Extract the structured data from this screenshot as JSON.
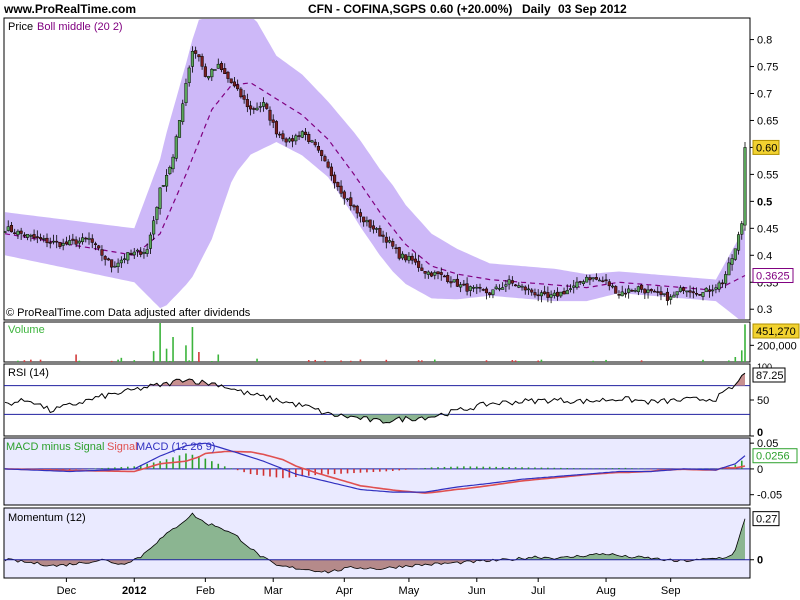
{
  "header": {
    "site": "www.ProRealTime.com",
    "instrument": "CFN - COFINA,SGPS",
    "quote": "0.60 (+20.00%)",
    "period": "Daily",
    "date": "03 Sep 2012"
  },
  "colors": {
    "bollinger_band": "#cdb8f8",
    "bollinger_middle": "#800080",
    "candle_up": "#5aa55a",
    "candle_down": "#7a1f1f",
    "volume_up": "#3cb43c",
    "volume_down": "#d23c3c",
    "macd_line": "#3030c0",
    "signal_line": "#e05050",
    "hist_up": "#2ca02c",
    "hist_down": "#d03030",
    "momentum_fill": "#8bb591",
    "panel_bg": "#eaeaff",
    "last_price_bg": "#f2d230"
  },
  "x_axis_labels": [
    "Dec",
    "2012",
    "Feb",
    "Mar",
    "Apr",
    "May",
    "Jun",
    "Jul",
    "Aug",
    "Sep"
  ],
  "chart_data": [
    {
      "type": "candlestick",
      "panel": "price",
      "title": "Price",
      "overlay_label": "Boll middle (20 2)",
      "footnote": "© ProRealTime.com Data adjusted after dividends",
      "ylim": [
        0.28,
        0.84
      ],
      "y_ticks": [
        0.3,
        0.35,
        0.4,
        0.45,
        0.5,
        0.55,
        0.6,
        0.65,
        0.7,
        0.75,
        0.8
      ],
      "y_tick_labels": [
        "0.3",
        "0.35",
        "0.4",
        "0.45",
        "0.5",
        "0.55",
        "0.6",
        "0.65",
        "0.7",
        "0.75",
        "0.8"
      ],
      "last_price": 0.6,
      "last_price_label": "0.60",
      "boll_middle_last": 0.3625,
      "boll_middle_last_label": "0.3625",
      "close_anchors": [
        [
          0,
          0.45
        ],
        [
          10,
          0.43
        ],
        [
          18,
          0.42
        ],
        [
          26,
          0.43
        ],
        [
          33,
          0.38
        ],
        [
          38,
          0.4
        ],
        [
          44,
          0.41
        ],
        [
          48,
          0.52
        ],
        [
          52,
          0.58
        ],
        [
          56,
          0.72
        ],
        [
          58,
          0.78
        ],
        [
          60,
          0.77
        ],
        [
          62,
          0.73
        ],
        [
          66,
          0.75
        ],
        [
          70,
          0.72
        ],
        [
          76,
          0.67
        ],
        [
          80,
          0.68
        ],
        [
          84,
          0.63
        ],
        [
          88,
          0.61
        ],
        [
          92,
          0.63
        ],
        [
          96,
          0.6
        ],
        [
          100,
          0.56
        ],
        [
          104,
          0.52
        ],
        [
          110,
          0.47
        ],
        [
          114,
          0.45
        ],
        [
          118,
          0.43
        ],
        [
          122,
          0.4
        ],
        [
          126,
          0.39
        ],
        [
          130,
          0.37
        ],
        [
          136,
          0.36
        ],
        [
          142,
          0.34
        ],
        [
          150,
          0.33
        ],
        [
          156,
          0.35
        ],
        [
          160,
          0.34
        ],
        [
          168,
          0.32
        ],
        [
          172,
          0.33
        ],
        [
          176,
          0.34
        ],
        [
          180,
          0.36
        ],
        [
          186,
          0.35
        ],
        [
          190,
          0.33
        ],
        [
          196,
          0.34
        ],
        [
          200,
          0.33
        ],
        [
          206,
          0.32
        ],
        [
          210,
          0.34
        ],
        [
          216,
          0.33
        ],
        [
          222,
          0.35
        ],
        [
          226,
          0.41
        ],
        [
          228,
          0.46
        ],
        [
          229,
          0.6
        ]
      ],
      "boll_middle_anchors": [
        [
          0,
          0.44
        ],
        [
          20,
          0.42
        ],
        [
          40,
          0.4
        ],
        [
          48,
          0.44
        ],
        [
          56,
          0.55
        ],
        [
          64,
          0.67
        ],
        [
          70,
          0.715
        ],
        [
          76,
          0.72
        ],
        [
          84,
          0.69
        ],
        [
          92,
          0.66
        ],
        [
          100,
          0.615
        ],
        [
          108,
          0.55
        ],
        [
          116,
          0.48
        ],
        [
          124,
          0.42
        ],
        [
          132,
          0.38
        ],
        [
          140,
          0.365
        ],
        [
          150,
          0.355
        ],
        [
          160,
          0.35
        ],
        [
          170,
          0.345
        ],
        [
          180,
          0.34
        ],
        [
          190,
          0.35
        ],
        [
          200,
          0.345
        ],
        [
          210,
          0.34
        ],
        [
          220,
          0.335
        ],
        [
          229,
          0.3625
        ]
      ],
      "boll_halfwidth_anchors": [
        [
          0,
          0.04
        ],
        [
          40,
          0.05
        ],
        [
          50,
          0.16
        ],
        [
          58,
          0.22
        ],
        [
          64,
          0.24
        ],
        [
          72,
          0.16
        ],
        [
          84,
          0.08
        ],
        [
          100,
          0.07
        ],
        [
          110,
          0.08
        ],
        [
          120,
          0.08
        ],
        [
          132,
          0.06
        ],
        [
          150,
          0.03
        ],
        [
          170,
          0.03
        ],
        [
          190,
          0.02
        ],
        [
          210,
          0.02
        ],
        [
          220,
          0.02
        ],
        [
          229,
          0.09
        ]
      ]
    },
    {
      "type": "bar",
      "panel": "volume",
      "title": "Volume",
      "y_ticks": [
        200000
      ],
      "y_tick_labels": [
        "200,000"
      ],
      "last_value": 451270,
      "last_value_label": "451,270",
      "ylim": [
        0,
        480000
      ],
      "spikes": [
        [
          22,
          90000
        ],
        [
          36,
          50000
        ],
        [
          46,
          130000
        ],
        [
          48,
          480000
        ],
        [
          50,
          160000
        ],
        [
          52,
          300000
        ],
        [
          56,
          200000
        ],
        [
          58,
          420000
        ],
        [
          60,
          120000
        ],
        [
          66,
          90000
        ],
        [
          78,
          40000
        ],
        [
          110,
          30000
        ],
        [
          186,
          25000
        ],
        [
          226,
          60000
        ],
        [
          228,
          140000
        ],
        [
          229,
          451270
        ]
      ]
    },
    {
      "type": "line",
      "panel": "rsi",
      "title": "RSI (14)",
      "ylim": [
        0,
        100
      ],
      "y_ticks": [
        0,
        50
      ],
      "y_tick_labels": [
        "0",
        "50"
      ],
      "top_tick_label": "100",
      "levels": [
        70,
        30
      ],
      "last_value": 87.25,
      "last_value_label": "87.25",
      "anchors": [
        [
          0,
          45
        ],
        [
          8,
          50
        ],
        [
          14,
          35
        ],
        [
          22,
          45
        ],
        [
          30,
          55
        ],
        [
          38,
          62
        ],
        [
          44,
          68
        ],
        [
          50,
          72
        ],
        [
          56,
          80
        ],
        [
          60,
          75
        ],
        [
          66,
          72
        ],
        [
          74,
          60
        ],
        [
          84,
          50
        ],
        [
          94,
          40
        ],
        [
          100,
          30
        ],
        [
          108,
          26
        ],
        [
          116,
          20
        ],
        [
          124,
          24
        ],
        [
          132,
          27
        ],
        [
          140,
          35
        ],
        [
          150,
          45
        ],
        [
          160,
          48
        ],
        [
          170,
          50
        ],
        [
          180,
          48
        ],
        [
          190,
          52
        ],
        [
          200,
          47
        ],
        [
          210,
          50
        ],
        [
          220,
          52
        ],
        [
          226,
          70
        ],
        [
          229,
          87.25
        ]
      ]
    },
    {
      "type": "line",
      "panel": "macd",
      "title": "MACD minus Signal",
      "series": [
        {
          "name": "MACD minus Signal"
        },
        {
          "name": "Signal"
        },
        {
          "name": "MACD (12 26 9)"
        }
      ],
      "ylim": [
        -0.07,
        0.06
      ],
      "y_ticks": [
        0.05,
        0,
        -0.05
      ],
      "y_tick_labels": [
        "0.05",
        "0",
        "-0.05"
      ],
      "last_value": 0.0256,
      "last_value_label": "0.0256",
      "macd_anchors": [
        [
          0,
          0.0
        ],
        [
          20,
          -0.005
        ],
        [
          40,
          0.0
        ],
        [
          48,
          0.025
        ],
        [
          56,
          0.045
        ],
        [
          62,
          0.05
        ],
        [
          70,
          0.035
        ],
        [
          80,
          0.015
        ],
        [
          90,
          -0.01
        ],
        [
          100,
          -0.025
        ],
        [
          110,
          -0.04
        ],
        [
          120,
          -0.045
        ],
        [
          130,
          -0.045
        ],
        [
          140,
          -0.035
        ],
        [
          150,
          -0.028
        ],
        [
          160,
          -0.02
        ],
        [
          170,
          -0.015
        ],
        [
          180,
          -0.01
        ],
        [
          190,
          -0.005
        ],
        [
          200,
          -0.005
        ],
        [
          210,
          0.0
        ],
        [
          220,
          -0.002
        ],
        [
          226,
          0.01
        ],
        [
          229,
          0.0256
        ]
      ],
      "hist_anchors": [
        [
          0,
          0.0
        ],
        [
          20,
          -0.002
        ],
        [
          40,
          0.005
        ],
        [
          48,
          0.015
        ],
        [
          56,
          0.03
        ],
        [
          60,
          0.025
        ],
        [
          68,
          0.005
        ],
        [
          76,
          -0.01
        ],
        [
          86,
          -0.018
        ],
        [
          96,
          -0.012
        ],
        [
          108,
          -0.008
        ],
        [
          120,
          -0.004
        ],
        [
          132,
          0.003
        ],
        [
          142,
          0.005
        ],
        [
          152,
          0.004
        ],
        [
          162,
          0.003
        ],
        [
          172,
          0.002
        ],
        [
          182,
          0.001
        ],
        [
          192,
          0.002
        ],
        [
          202,
          -0.001
        ],
        [
          212,
          0.001
        ],
        [
          222,
          0.0
        ],
        [
          226,
          0.008
        ],
        [
          229,
          0.02
        ]
      ]
    },
    {
      "type": "area",
      "panel": "momentum",
      "title": "Momentum (12)",
      "ylim": [
        -0.12,
        0.34
      ],
      "y_ticks": [
        0
      ],
      "y_tick_labels": [
        "0"
      ],
      "last_value": 0.27,
      "last_value_label": "0.27",
      "anchors": [
        [
          0,
          0.0
        ],
        [
          8,
          -0.02
        ],
        [
          16,
          -0.04
        ],
        [
          24,
          -0.02
        ],
        [
          30,
          0.0
        ],
        [
          36,
          -0.03
        ],
        [
          42,
          0.02
        ],
        [
          46,
          0.1
        ],
        [
          52,
          0.2
        ],
        [
          58,
          0.3
        ],
        [
          62,
          0.24
        ],
        [
          66,
          0.22
        ],
        [
          72,
          0.15
        ],
        [
          78,
          0.04
        ],
        [
          84,
          -0.04
        ],
        [
          92,
          -0.06
        ],
        [
          100,
          -0.08
        ],
        [
          108,
          -0.05
        ],
        [
          116,
          -0.06
        ],
        [
          124,
          -0.04
        ],
        [
          132,
          -0.03
        ],
        [
          140,
          -0.02
        ],
        [
          148,
          -0.01
        ],
        [
          156,
          0.0
        ],
        [
          164,
          0.02
        ],
        [
          172,
          0.01
        ],
        [
          180,
          0.03
        ],
        [
          186,
          0.04
        ],
        [
          192,
          0.02
        ],
        [
          200,
          0.01
        ],
        [
          208,
          -0.01
        ],
        [
          216,
          0.0
        ],
        [
          224,
          0.02
        ],
        [
          226,
          0.06
        ],
        [
          229,
          0.27
        ]
      ]
    }
  ]
}
